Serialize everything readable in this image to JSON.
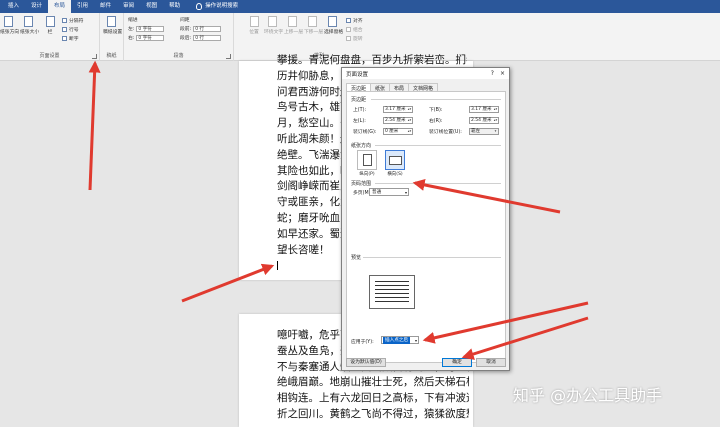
{
  "ribbon": {
    "tabs": [
      "插入",
      "设计",
      "布局",
      "引用",
      "邮件",
      "审阅",
      "视图",
      "帮助",
      "操作说明搜索"
    ],
    "active_tab": "布局",
    "page_setup": {
      "orientation_label": "纸张方向",
      "size_label": "纸张大小",
      "columns_label": "栏",
      "breaks_label": "分隔符",
      "line_numbers_label": "行号",
      "hyphenation_label": "断字",
      "group_label": "页面设置"
    },
    "draft": {
      "label": "稿纸设置",
      "group_label": "稿纸"
    },
    "indent": {
      "title": "缩进",
      "left_label": "左:",
      "left_value": "0 字符",
      "right_label": "右:",
      "right_value": "0 字符"
    },
    "spacing": {
      "title": "间距",
      "before_label": "段前:",
      "before_value": "0 行",
      "after_label": "段后:",
      "after_value": "0 行"
    },
    "paragraph_group_label": "段落",
    "arrange": {
      "position_label": "位置",
      "wrap_label": "环绕文字",
      "forward_label": "上移一层",
      "backward_label": "下移一层",
      "selection_pane_label": "选择窗格",
      "align_label": "对齐",
      "group_btn_label": "组合",
      "rotate_label": "旋转",
      "group_label": "排列"
    }
  },
  "document": {
    "page1_lines": [
      "攀援。青泥何盘盘，百步九折萦岩峦。扪参",
      "历井仰胁息，以",
      "问君西游何时还",
      "鸟号古木，雄飞",
      "月，愁空山。蜀",
      "听此凋朱颜！连",
      "绝壁。飞湍瀑流",
      "其险也如此，嗟",
      "剑阁峥嵘而崔嵬",
      "守或匪亲，化为",
      "蛇；磨牙吮血，",
      "如早还家。蜀道",
      "望长咨嗟！"
    ],
    "page2_lines": [
      "噫吁嚱，危乎高",
      "蚕丛及鱼凫，开",
      "不与秦塞通人烟。西当太白有鸟道，可以横",
      "绝峨眉巅。地崩山摧壮士死，然后天梯石栈",
      "相钩连。上有六龙回日之高标，下有冲波逆",
      "折之回川。黄鹤之飞尚不得过，猿猱欲度愁"
    ]
  },
  "dialog": {
    "title": "页面设置",
    "help": "?",
    "close": "×",
    "tabs": [
      "页边距",
      "纸张",
      "布局",
      "文档网格"
    ],
    "margins_section": "页边距",
    "top_label": "上(T):",
    "top_value": "3.17 厘米",
    "bottom_label": "下(B):",
    "bottom_value": "3.17 厘米",
    "left_label": "左(L):",
    "left_value": "2.54 厘米",
    "right_label": "右(R):",
    "right_value": "2.54 厘米",
    "gutter_label": "装订线(G):",
    "gutter_value": "0 厘米",
    "gutter_pos_label": "装订线位置(U):",
    "gutter_pos_value": "靠左",
    "orientation_section": "纸张方向",
    "portrait_label": "纵向(P)",
    "landscape_label": "横向(S)",
    "pages_section": "页码范围",
    "multiple_pages_label": "多页(M):",
    "multiple_pages_value": "普通",
    "preview_section": "预览",
    "apply_to_label": "应用于(Y):",
    "apply_to_value": "插入点之后",
    "set_default": "设为默认值(D)",
    "ok": "确定",
    "cancel": "取消"
  },
  "watermark": "知乎 @办公工具助手",
  "colors": {
    "ribbon_blue": "#2b579a",
    "arrow_red": "#e03a2f",
    "selection_blue": "#3e7bd6"
  }
}
